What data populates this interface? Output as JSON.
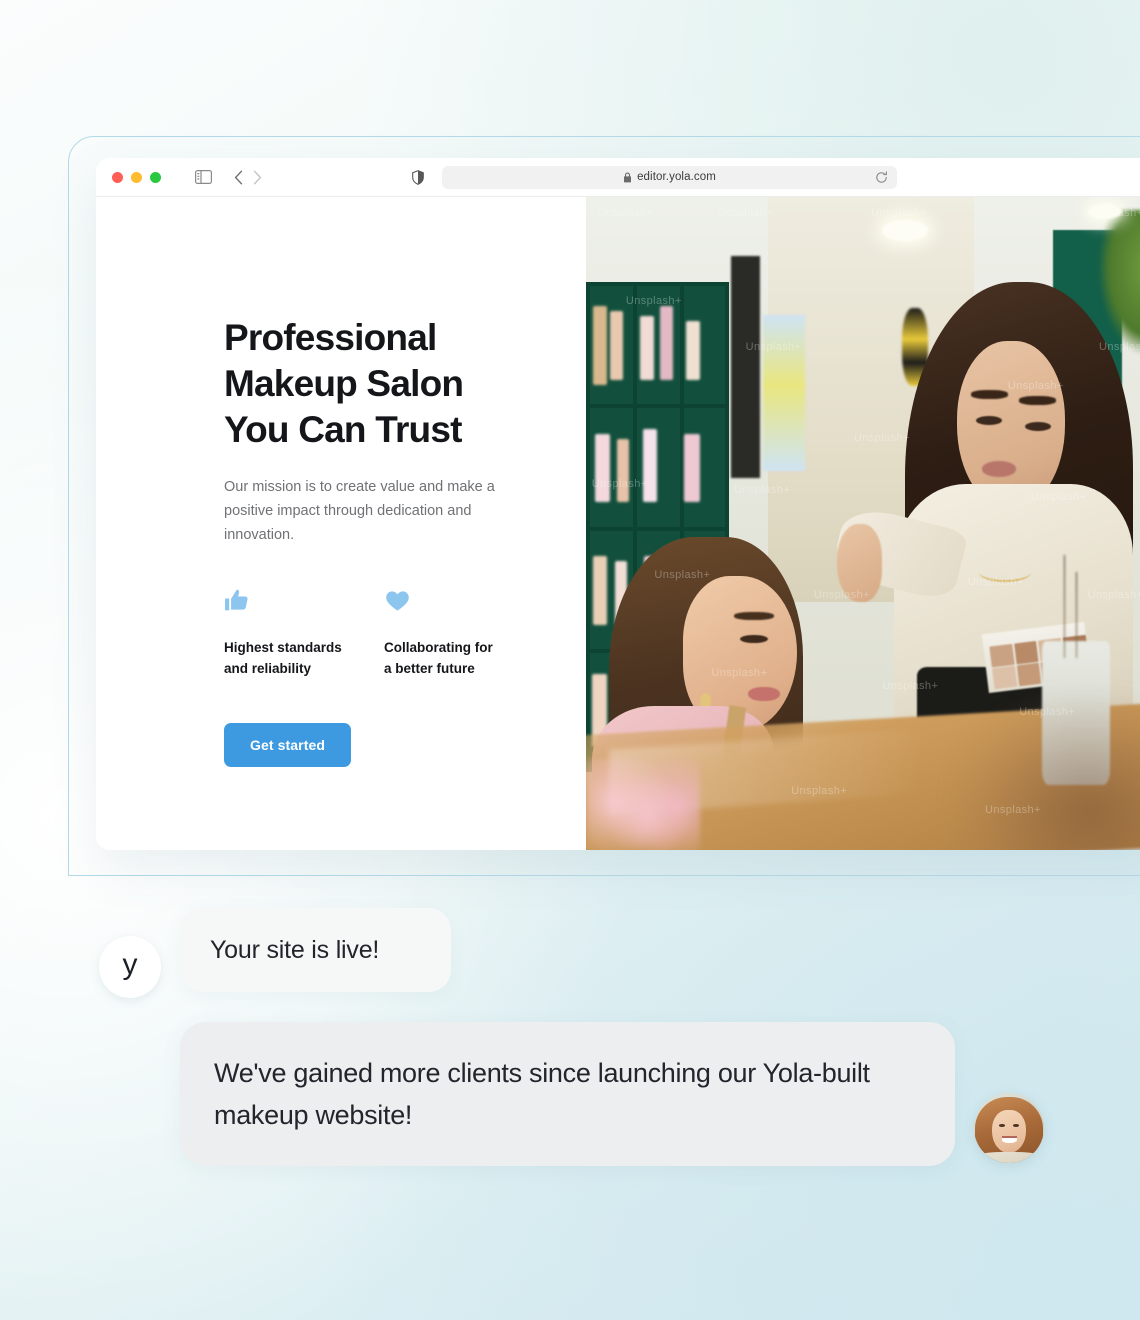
{
  "browser": {
    "traffic_lights": [
      {
        "name": "close",
        "color": "#ff5f57"
      },
      {
        "name": "minimize",
        "color": "#febc2e"
      },
      {
        "name": "maximize",
        "color": "#28c840"
      }
    ],
    "sidebar_toggle_icon": "sidebar-toggle-icon",
    "back_icon": "chevron-left-icon",
    "forward_icon": "chevron-right-icon",
    "shield_icon": "shield-privacy-icon",
    "lock_icon": "lock-icon",
    "reload_icon": "reload-icon",
    "url": "editor.yola.com"
  },
  "hero": {
    "heading": "Professional\nMakeup Salon\nYou Can Trust",
    "subtext": "Our mission is to create value and make a positive impact through dedication and innovation.",
    "features": [
      {
        "icon": "thumbs-up-icon",
        "label": "Highest standards\nand reliability"
      },
      {
        "icon": "heart-icon",
        "label": "Collaborating for\na better future"
      }
    ],
    "cta_label": "Get started",
    "photo_alt": "Makeup artist applying makeup to a smiling client in a salon",
    "photo_watermark": "Unsplash+"
  },
  "chat": {
    "brand_logo_letter": "y",
    "status_message": "Your site is live!",
    "testimonial": "We've gained more clients since launching our Yola-built makeup website!",
    "client_avatar_alt": "Smiling woman with wavy auburn hair"
  },
  "colors": {
    "accent_blue": "#3d9ae0",
    "icon_blue": "#8cc6ef",
    "heading_dark": "#15161a",
    "body_gray": "#6f7175",
    "frame_border": "#b4d9e8",
    "bubble_light": "#f6f7f7",
    "bubble_gray": "#edeef0"
  }
}
